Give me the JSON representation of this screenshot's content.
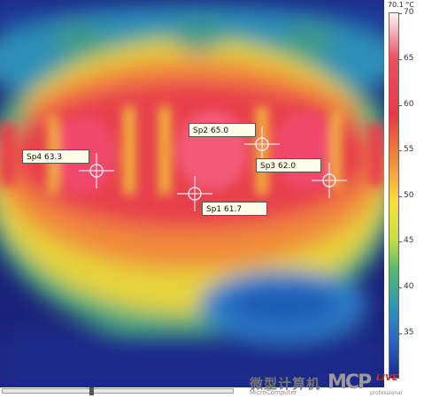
{
  "spots": [
    {
      "id": "sp4",
      "label": "Sp4 63.3"
    },
    {
      "id": "sp2",
      "label": "Sp2 65.0"
    },
    {
      "id": "sp3",
      "label": "Sp3 62.0"
    },
    {
      "id": "sp1",
      "label": "Sp1 61.7"
    }
  ],
  "scale": {
    "max_label": "70.1 °C",
    "ticks": [
      "70",
      "65",
      "60",
      "55",
      "50",
      "45",
      "40",
      "35"
    ]
  },
  "watermark": {
    "cn": "微型计算机",
    "sub": "MicroComputer",
    "mcp": "MCP",
    "live": "LIVE",
    "pro": "professional"
  }
}
